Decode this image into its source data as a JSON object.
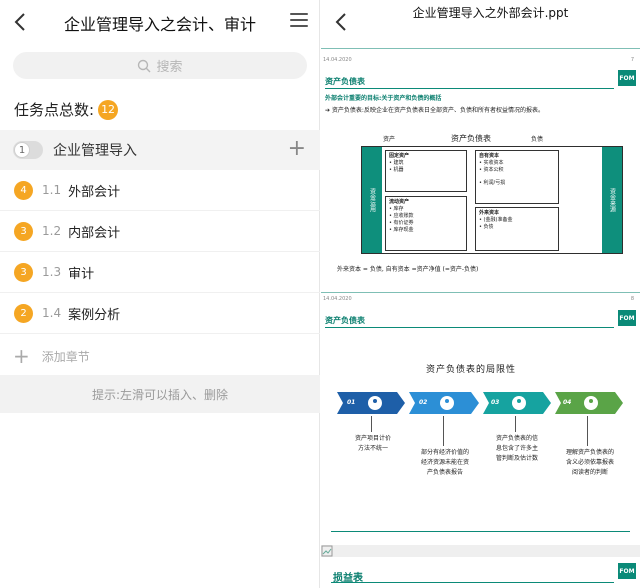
{
  "left": {
    "header": {
      "title": "企业管理导入之会计、审计"
    },
    "search": {
      "placeholder": "搜索"
    },
    "task_count": {
      "label": "任务点总数:",
      "value": "12"
    },
    "module": {
      "index": "1",
      "title": "企业管理导入"
    },
    "chapters": [
      {
        "badge": "4",
        "index": "1.1",
        "name": "外部会计"
      },
      {
        "badge": "3",
        "index": "1.2",
        "name": "内部会计"
      },
      {
        "badge": "3",
        "index": "1.3",
        "name": "审计"
      },
      {
        "badge": "2",
        "index": "1.4",
        "name": "案例分析"
      }
    ],
    "add_chapter": "添加章节",
    "hint": "提示:左滑可以插入、删除"
  },
  "right": {
    "header": {
      "title": "企业管理导入之外部会计.ppt"
    },
    "slide1": {
      "date": "14.04.2020",
      "page": "7",
      "title": "资产负债表",
      "logo": "FOM",
      "subtitle": "外部会计重要的目标:关于资产和负债的概括",
      "description": "➔ 资产负债表:反映企业在资产负债表日全部资产、负债和所有者权益情况的报表。",
      "left_col": "资产",
      "center": "资产负债表",
      "right_col": "负债",
      "left_side": "资金运用",
      "right_side": "资金来源",
      "fixed_assets": {
        "title": "固定资产",
        "items": [
          "• 建筑",
          "• 机器"
        ]
      },
      "current_assets": {
        "title": "流动资产",
        "items": [
          "• 库存",
          "• 应收账款",
          "• 有价证券",
          "• 库存现金"
        ]
      },
      "equity": {
        "title": "自有资本",
        "items": [
          "• 实收资本",
          "• 资本公积",
          "• 利润/亏损"
        ]
      },
      "liabilities": {
        "title": "外来资本",
        "items": [
          "• (金融)准备金",
          "• 负债"
        ]
      },
      "equation": "外来资本 = 负债, 自有资本 =资产净值 (=资产-负债)"
    },
    "slide2": {
      "date": "14.04.2020",
      "page": "8",
      "title": "资产负债表",
      "logo": "FOM",
      "heading": "资产负债表的局限性",
      "steps": [
        {
          "num": "01",
          "text": [
            "资产项目计价",
            "方法不统一"
          ],
          "color": "#1e5fa8"
        },
        {
          "num": "02",
          "text": [
            "部分有经济价值的",
            "经济资源未能在资",
            "产负债表报告"
          ],
          "color": "#2c8fd6"
        },
        {
          "num": "03",
          "text": [
            "资产负债表的信",
            "息包含了许多主",
            "管判断及估计数"
          ],
          "color": "#16a3a0"
        },
        {
          "num": "04",
          "text": [
            "理解资产负债表的",
            "含义必须依靠报表",
            "阅读者的判断"
          ],
          "color": "#5aa447"
        }
      ]
    },
    "slide3": {
      "title": "损益表",
      "logo": "FOM"
    }
  }
}
